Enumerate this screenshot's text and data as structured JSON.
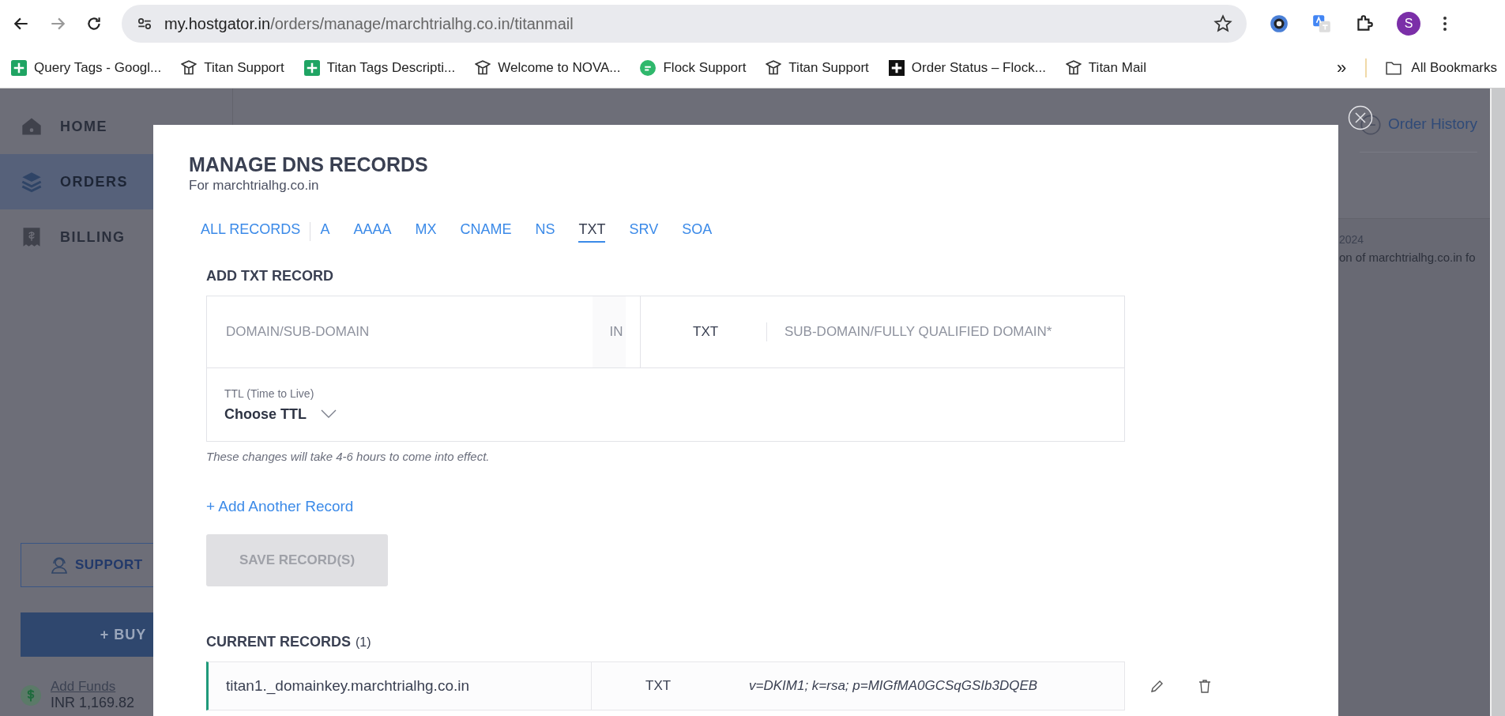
{
  "browser": {
    "url_host": "my.hostgator.in",
    "url_path": "/orders/manage/marchtrialhg.co.in/titanmail",
    "profile_initial": "S"
  },
  "bookmarks": [
    {
      "label": "Query Tags - Googl...",
      "kind": "sheet"
    },
    {
      "label": "Titan Support",
      "kind": "titan"
    },
    {
      "label": "Titan Tags Descripti...",
      "kind": "sheet"
    },
    {
      "label": "Welcome to NOVA...",
      "kind": "titan"
    },
    {
      "label": "Flock Support",
      "kind": "flock"
    },
    {
      "label": "Titan Support",
      "kind": "titan"
    },
    {
      "label": "Order Status – Flock...",
      "kind": "plus"
    },
    {
      "label": "Titan Mail",
      "kind": "titan"
    }
  ],
  "bookmarks_overflow": "»",
  "all_bookmarks": "All Bookmarks",
  "sidebar": {
    "items": [
      {
        "label": "HOME",
        "kind": "home",
        "selected": false
      },
      {
        "label": "ORDERS",
        "kind": "orders",
        "selected": true
      },
      {
        "label": "BILLING",
        "kind": "billing",
        "selected": false
      }
    ],
    "support": "SUPPORT",
    "buy": "+ BUY",
    "add_funds": "Add Funds",
    "balance": "INR 1,169.82"
  },
  "background": {
    "order_history": "Order History",
    "date_fragment": "2024",
    "text_fragment": "on of marchtrialhg.co.in fo"
  },
  "modal": {
    "title": "MANAGE DNS RECORDS",
    "subtitle": "For marchtrialhg.co.in",
    "tabs": [
      {
        "label": "ALL RECORDS",
        "selected": false
      },
      {
        "label": "A",
        "selected": false
      },
      {
        "label": "AAAA",
        "selected": false
      },
      {
        "label": "MX",
        "selected": false
      },
      {
        "label": "CNAME",
        "selected": false
      },
      {
        "label": "NS",
        "selected": false
      },
      {
        "label": "TXT",
        "selected": true
      },
      {
        "label": "SRV",
        "selected": false
      },
      {
        "label": "SOA",
        "selected": false
      }
    ],
    "add_title": "ADD TXT RECORD",
    "form": {
      "domain_placeholder": "DOMAIN/SUB-DOMAIN",
      "class_label": "IN",
      "type": "TXT",
      "target_placeholder": "SUB-DOMAIN/FULLY QUALIFIED DOMAIN*",
      "ttl_label": "TTL (Time to Live)",
      "ttl_value": "Choose TTL"
    },
    "note": "These changes will take 4-6 hours to come into effect.",
    "add_another": "+ Add Another Record",
    "save_button": {
      "label": "SAVE RECORD(S)",
      "disabled": true
    },
    "current_title": "CURRENT RECORDS",
    "current_count": "(1)",
    "records": [
      {
        "host": "titan1._domainkey.marchtrialhg.co.in",
        "type": "TXT",
        "value": "v=DKIM1; k=rsa; p=MIGfMA0GCSqGSIb3DQEB"
      }
    ]
  }
}
